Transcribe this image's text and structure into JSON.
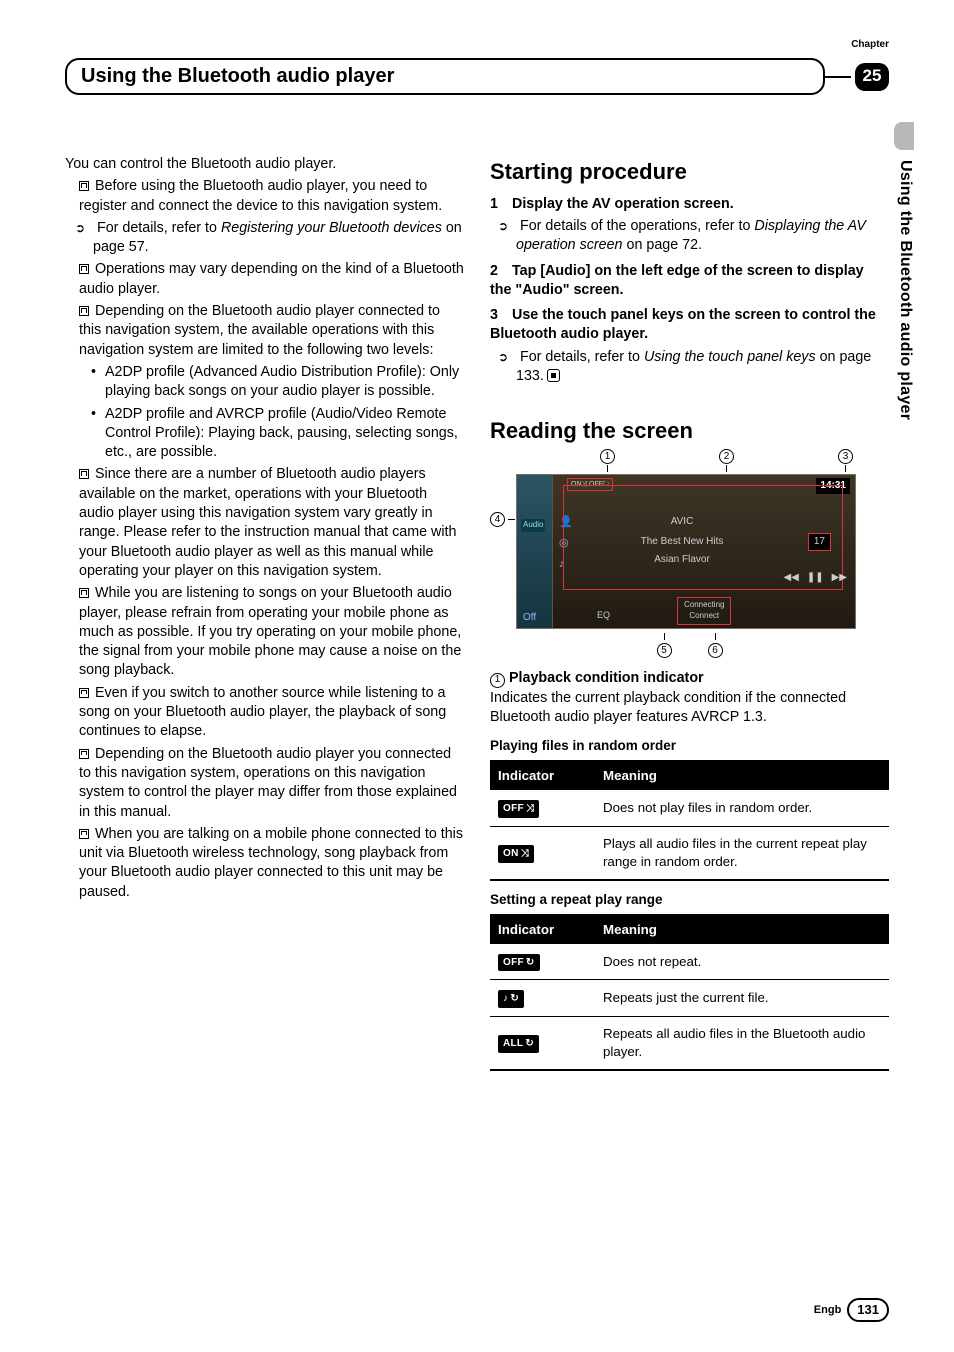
{
  "header": {
    "chapter_label": "Chapter",
    "title": "Using the Bluetooth audio player",
    "chapter_number": "25",
    "side_label": "Using the Bluetooth audio player"
  },
  "left": {
    "intro": "You can control the Bluetooth audio player.",
    "b1": "Before using the Bluetooth audio player, you need to register and connect the device to this navigation system.",
    "b1_ref_pre": "For details, refer to ",
    "b1_ref_it": "Registering your Bluetooth devices",
    "b1_ref_post": " on page 57.",
    "b2": "Operations may vary depending on the kind of a Bluetooth audio player.",
    "b3": "Depending on the Bluetooth audio player connected to this navigation system, the available operations with this navigation system are limited to the following two levels:",
    "b3a": "A2DP profile (Advanced Audio Distribution Profile): Only playing back songs on your audio player is possible.",
    "b3b": "A2DP profile and AVRCP profile (Audio/Video Remote Control Profile): Playing back, pausing, selecting songs, etc., are possible.",
    "b4": "Since there are a number of Bluetooth audio players available on the market, operations with your Bluetooth audio player using this navigation system vary greatly in range. Please refer to the instruction manual that came with your Bluetooth audio player as well as this manual while operating your player on this navigation system.",
    "b5": "While you are listening to songs on your Bluetooth audio player, please refrain from operating your mobile phone as much as possible. If you try operating on your mobile phone, the signal from your mobile phone may cause a noise on the song playback.",
    "b6": "Even if you switch to another source while listening to a song on your Bluetooth audio player, the playback of song continues to elapse.",
    "b7": "Depending on the Bluetooth audio player you connected to this navigation system, operations on this navigation system to control the player may differ from those explained in this manual.",
    "b8": "When you are talking on a mobile phone connected to this unit via Bluetooth wireless technology, song playback from your Bluetooth audio player connected to this unit may be paused."
  },
  "right": {
    "h_start": "Starting procedure",
    "s1": "Display the AV operation screen.",
    "s1_sub_pre": "For details of the operations, refer to ",
    "s1_sub_it": "Displaying the AV operation screen",
    "s1_sub_post": " on page 72.",
    "s2": "Tap [Audio] on the left edge of the screen to display the \"Audio\" screen.",
    "s3": "Use the touch panel keys on the screen to control the Bluetooth audio player.",
    "s3_sub_pre": "For details, refer to ",
    "s3_sub_it": "Using the touch panel keys",
    "s3_sub_post": " on page 133.",
    "h_read": "Reading the screen",
    "shot": {
      "time": "14:31",
      "top_ind": "ON⤨  OFF↻",
      "left_audio": "Audio",
      "artist": "AVIC",
      "song": "The Best New Hits",
      "sub": "Asian Flavor",
      "track": "17",
      "off": "Off",
      "eq": "EQ",
      "conn_line1": "Connecting",
      "conn_line2": "Connect"
    },
    "desc1_title": "Playback condition indicator",
    "desc1_body": "Indicates the current playback condition if the connected Bluetooth audio player features AVRCP 1.3.",
    "t1_title": "Playing files in random order",
    "t1h1": "Indicator",
    "t1h2": "Meaning",
    "t1r1_ind": "OFF",
    "t1r1_m": "Does not play files in random order.",
    "t1r2_ind": "ON",
    "t1r2_m": "Plays all audio files in the current repeat play range in random order.",
    "t2_title": "Setting a repeat play range",
    "t2h1": "Indicator",
    "t2h2": "Meaning",
    "t2r1_ind": "OFF",
    "t2r1_m": "Does not repeat.",
    "t2r2_ind": "♪",
    "t2r2_m": "Repeats just the current file.",
    "t2r3_ind": "ALL",
    "t2r3_m": "Repeats all audio files in the Bluetooth audio player."
  },
  "footer": {
    "lang": "Engb",
    "page": "131"
  }
}
